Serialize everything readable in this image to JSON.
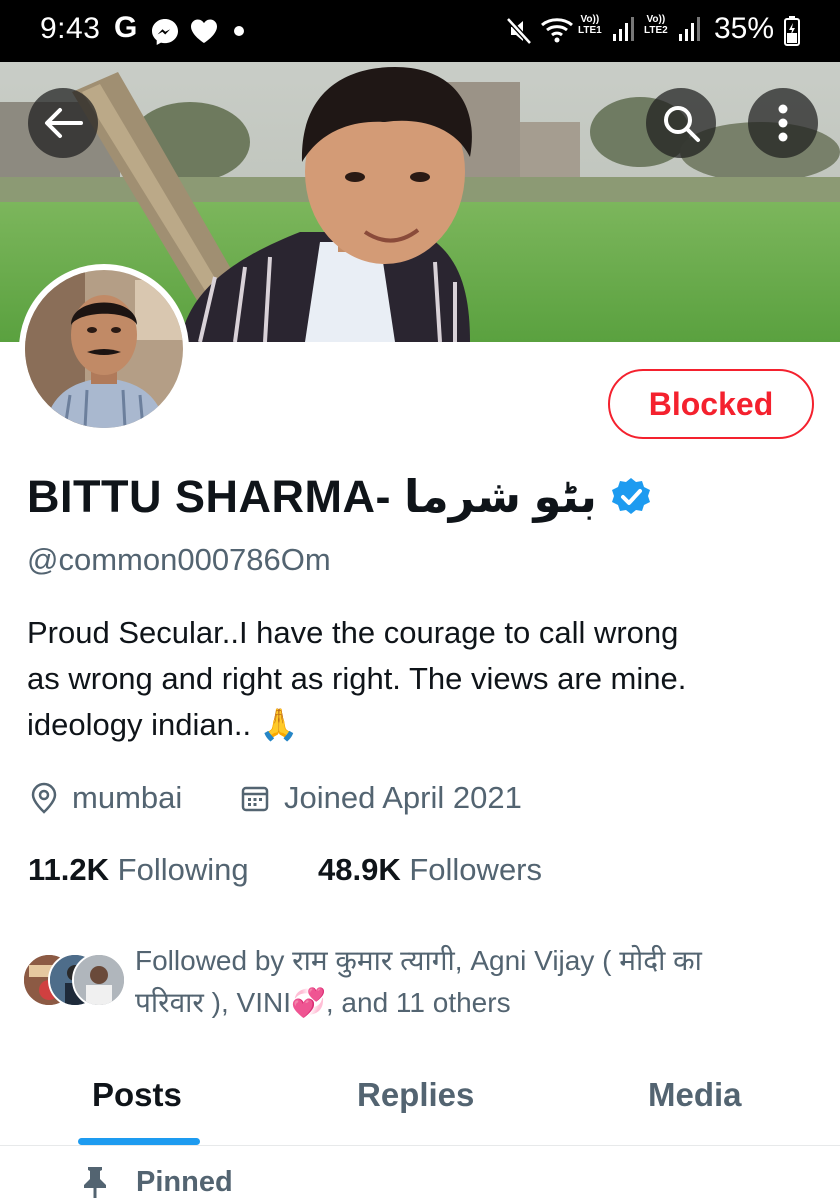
{
  "status_bar": {
    "time": "9:43",
    "carrier_g": "G",
    "lte1": "LTE1",
    "lte2": "LTE2",
    "volte1": "Vo))",
    "volte2": "Vo))",
    "battery": "35%",
    "icons": [
      "google-icon",
      "messenger-icon",
      "heart-icon",
      "dot-icon",
      "mute-icon",
      "wifi-icon",
      "signal-icon",
      "battery-icon"
    ]
  },
  "header": {
    "back_icon": "back-arrow-icon",
    "search_icon": "search-icon",
    "more_icon": "more-vertical-icon"
  },
  "profile": {
    "display_name": "BITTU SHARMA- بٹو شرما",
    "verified": true,
    "handle": "@common000786Om",
    "blocked_label": "Blocked",
    "bio": [
      "Proud Secular..I have the courage to call wrong",
      "as wrong and right as right.  The views are mine.",
      "ideology indian.. 🙏"
    ],
    "location": "mumbai",
    "joined": "Joined April 2021",
    "following_count": "11.2K",
    "following_label": "Following",
    "followers_count": "48.9K",
    "followers_label": "Followers",
    "followed_by": [
      "Followed by राम कुमार त्यागी, Agni Vijay ( मोदी का",
      "परिवार ), VINI💞, and 11 others"
    ]
  },
  "tabs": [
    {
      "label": "Posts",
      "active": true
    },
    {
      "label": "Replies",
      "active": false
    },
    {
      "label": "Media",
      "active": false
    }
  ],
  "pinned_label": "Pinned",
  "colors": {
    "accent": "#1d9bf0",
    "blocked": "#f4212e",
    "secondary_text": "#536471",
    "primary_text": "#0f1419"
  }
}
